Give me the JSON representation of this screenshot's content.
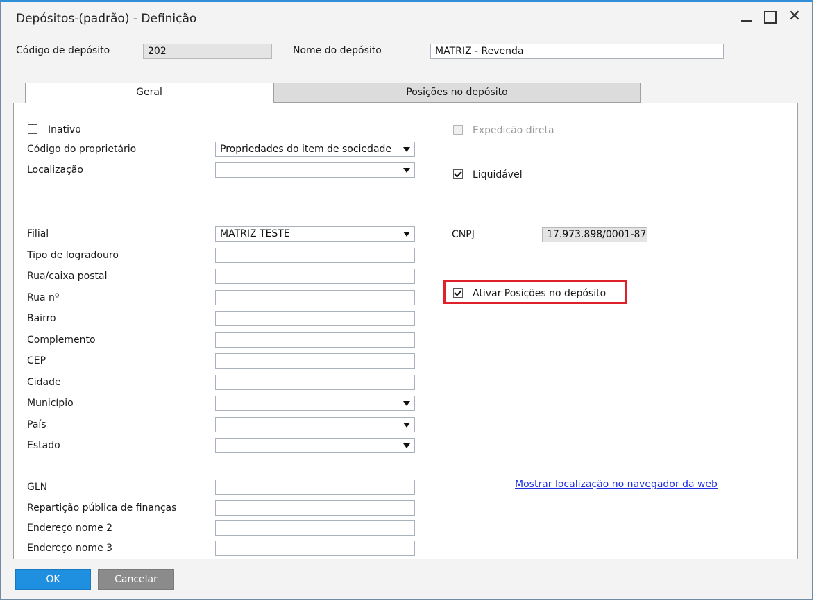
{
  "window": {
    "title": "Depósitos-(padrão) - Definição",
    "minimize": "minimize",
    "maximize": "maximize",
    "close": "✕"
  },
  "header": {
    "warehouse_code_label": "Código de depósito",
    "warehouse_code_value": "202",
    "warehouse_name_label": "Nome do depósito",
    "warehouse_name_value": "MATRIZ - Revenda"
  },
  "tabs": [
    {
      "label": "Geral",
      "active": true
    },
    {
      "label": "Posições no depósito",
      "active": false
    }
  ],
  "general": {
    "inactive_label": "Inativo",
    "inactive_checked": false,
    "owner_code_label": "Código do proprietário",
    "owner_code_value": "Propriedades do item de sociedade",
    "location_label": "Localização",
    "location_value": "",
    "direct_shipment_label": "Expedição direta",
    "direct_shipment_checked": false,
    "nettable_label": "Liquidável",
    "nettable_checked": true,
    "branch_label": "Filial",
    "branch_value": "MATRIZ TESTE",
    "cnpj_label": "CNPJ",
    "cnpj_value": "17.973.898/0001-87",
    "street_type_label": "Tipo de logradouro",
    "street_label": "Rua/caixa postal",
    "street_no_label": "Rua nº",
    "district_label": "Bairro",
    "complement_label": "Complemento",
    "zip_label": "CEP",
    "city_label": "Cidade",
    "county_label": "Município",
    "country_label": "País",
    "state_label": "Estado",
    "enable_bins_label": "Ativar Posições no depósito",
    "enable_bins_checked": true,
    "gln_label": "GLN",
    "tax_office_label": "Repartição pública de finanças",
    "address2_label": "Endereço nome 2",
    "address3_label": "Endereço nome 3",
    "web_map_link": "Mostrar localização no navegador da web"
  },
  "buttons": {
    "ok": "OK",
    "cancel": "Cancelar"
  },
  "colors": {
    "accent": "#1f8fe0",
    "highlight": "#e0202a",
    "link": "#1d2ee0"
  }
}
